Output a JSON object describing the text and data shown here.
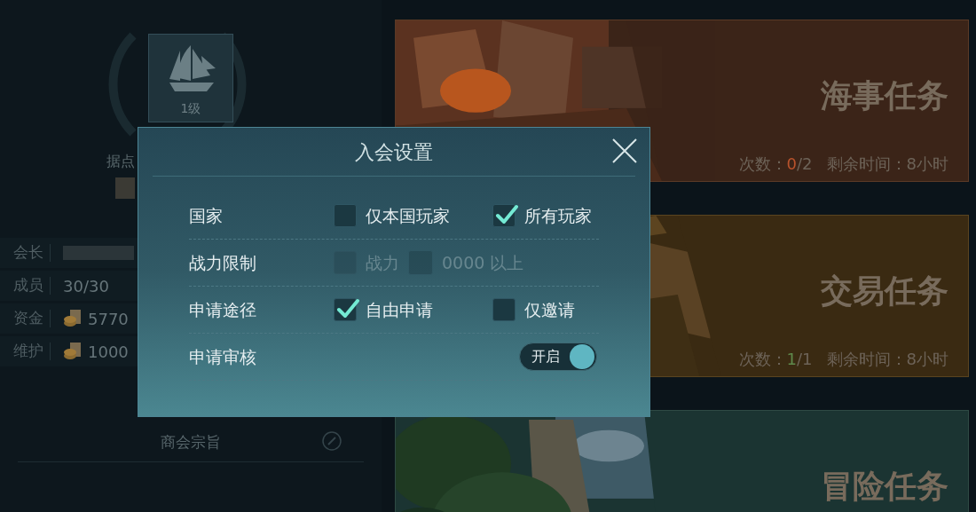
{
  "guild": {
    "level_badge": "1级",
    "base_label": "据点",
    "info": [
      {
        "label": "会长",
        "kind": "blurred"
      },
      {
        "label": "成员",
        "kind": "text",
        "value": "30/30"
      },
      {
        "label": "资金",
        "kind": "coin",
        "value": "5770"
      },
      {
        "label": "维护",
        "kind": "coin",
        "value": "1000"
      }
    ],
    "motto_label": "商会宗旨"
  },
  "tasks": [
    {
      "kind": "battle",
      "title": "海事任务",
      "count_label": "次数：",
      "count_done": "0",
      "count_total": "/2",
      "color": "#b9532c",
      "time": "剩余时间：8小时"
    },
    {
      "kind": "trade",
      "title": "交易任务",
      "count_label": "次数：",
      "count_done": "1",
      "count_total": "/1",
      "color": "#5f8a4c",
      "time": "剩余时间：8小时"
    },
    {
      "kind": "adventure",
      "title": "冒险任务"
    }
  ],
  "dialog": {
    "title": "入会设置",
    "rows": [
      {
        "label": "国家",
        "kind": "choices",
        "options": [
          {
            "label": "仅本国玩家",
            "checked": false
          },
          {
            "label": "所有玩家",
            "checked": true
          }
        ]
      },
      {
        "label": "战力限制",
        "kind": "power",
        "disabled": true,
        "checkbox": {
          "label": "战力",
          "checked": false
        },
        "suffix": "0000 以上"
      },
      {
        "label": "申请途径",
        "kind": "choices",
        "options": [
          {
            "label": "自由申请",
            "checked": true
          },
          {
            "label": "仅邀请",
            "checked": false
          }
        ]
      },
      {
        "label": "申请审核",
        "kind": "toggle",
        "on": true,
        "toggle_label": "开启"
      }
    ]
  }
}
